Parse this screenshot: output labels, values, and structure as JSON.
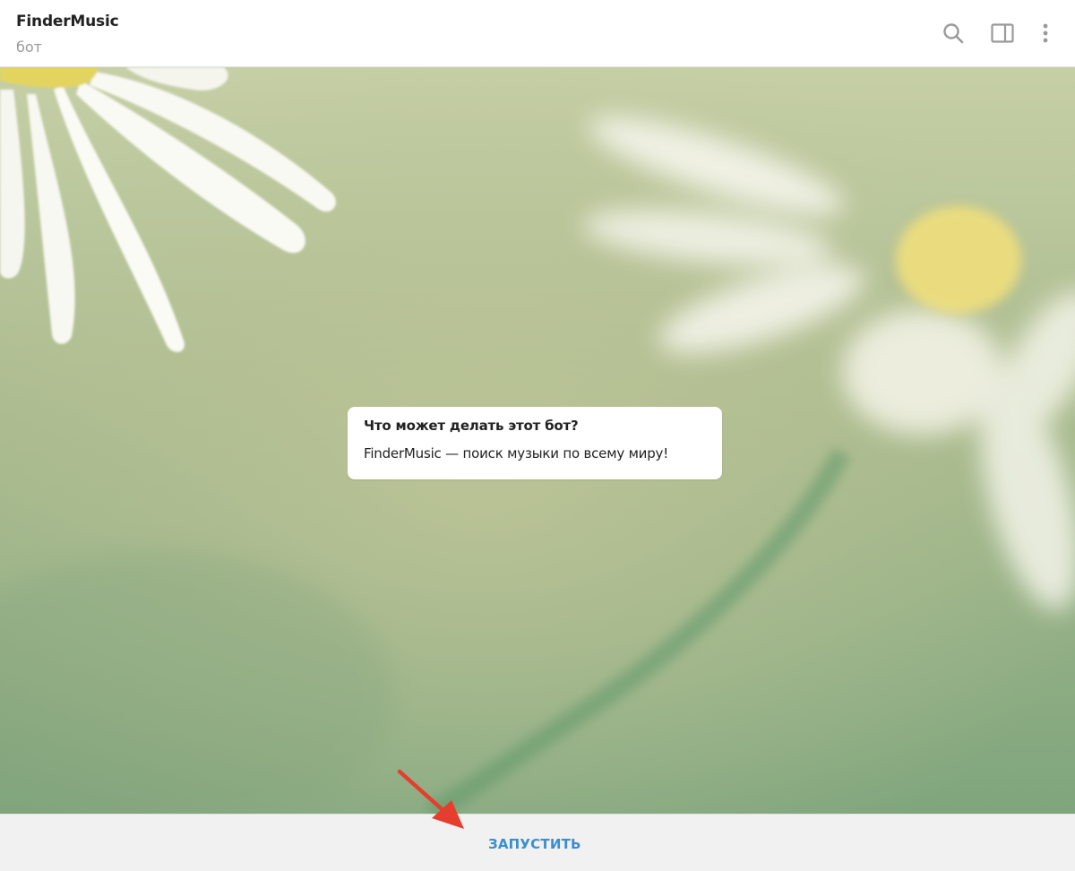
{
  "header": {
    "title": "FinderMusic",
    "subtitle": "бот",
    "icons": [
      "search-icon",
      "side-panel-icon",
      "more-vertical-icon"
    ]
  },
  "bot_info": {
    "title": "Что может делать этот бот?",
    "description": "FinderMusic — поиск музыки по всему миру!"
  },
  "bottom_bar": {
    "start_label": "ЗАПУСТИТЬ"
  },
  "colors": {
    "accent": "#3a8fcf",
    "annotation_arrow": "#e53e2f",
    "wallpaper": "#a9bc94"
  }
}
